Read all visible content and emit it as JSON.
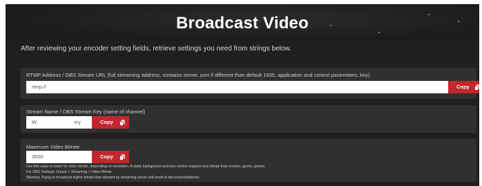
{
  "title": "Broadcast Video",
  "intro": "After reviewing your encoder setting fields, retrieve settings you need from strings below.",
  "rtmp": {
    "label": "RTMP Address / OBS Stream URL (full streaming address, contains server, port if different than default 1935, application and control parameters, key)",
    "value": "rtmp://",
    "copy_label": "Copy"
  },
  "stream_name": {
    "label": "Stream Name / OBS Stream Key (name of channel)",
    "value": "W",
    "value_suffix": "xry",
    "copy_label": "Copy"
  },
  "bitrate": {
    "label": "Maximum Video Bitrate",
    "value": "3500",
    "copy_label": "Copy",
    "notes": [
      "Use this value or lower for video bitrate, depending on resolution. A static background and less motion requires less bitrate than movies, sports, games.",
      "For OBS Settings: Output > Streaming > Video Bitrate.",
      "Warning: Trying to broadcast higher bitrate than allowed by streaming server will result in disconnects/failures."
    ]
  },
  "icons": {
    "copy": "copy-icon"
  },
  "colors": {
    "background": "#1f1f1f",
    "panel": "#303030",
    "accent": "#c1272d"
  }
}
